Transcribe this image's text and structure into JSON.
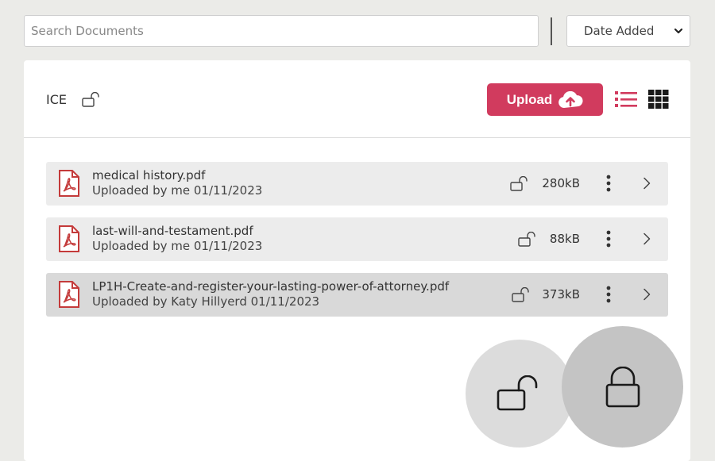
{
  "search": {
    "placeholder": "Search Documents",
    "value": ""
  },
  "sort": {
    "selected": "Date Added"
  },
  "folder": {
    "name": "ICE",
    "locked": false
  },
  "toolbar": {
    "upload_label": "Upload"
  },
  "documents": [
    {
      "name": "medical history.pdf",
      "meta": "Uploaded by me 01/11/2023",
      "size": "280kB",
      "locked": false,
      "selected": false
    },
    {
      "name": "last-will-and-testament.pdf",
      "meta": "Uploaded by me 01/11/2023",
      "size": "88kB",
      "locked": false,
      "selected": false
    },
    {
      "name": "LP1H-Create-and-register-your-lasting-power-of-attorney.pdf",
      "meta": "Uploaded by Katy Hillyerd 01/11/2023",
      "size": "373kB",
      "locked": false,
      "selected": true
    }
  ],
  "lock_options": [
    "unlock-icon",
    "lock-icon"
  ],
  "colors": {
    "accent": "#d13b5e",
    "pdf_icon": "#c43a3a"
  }
}
